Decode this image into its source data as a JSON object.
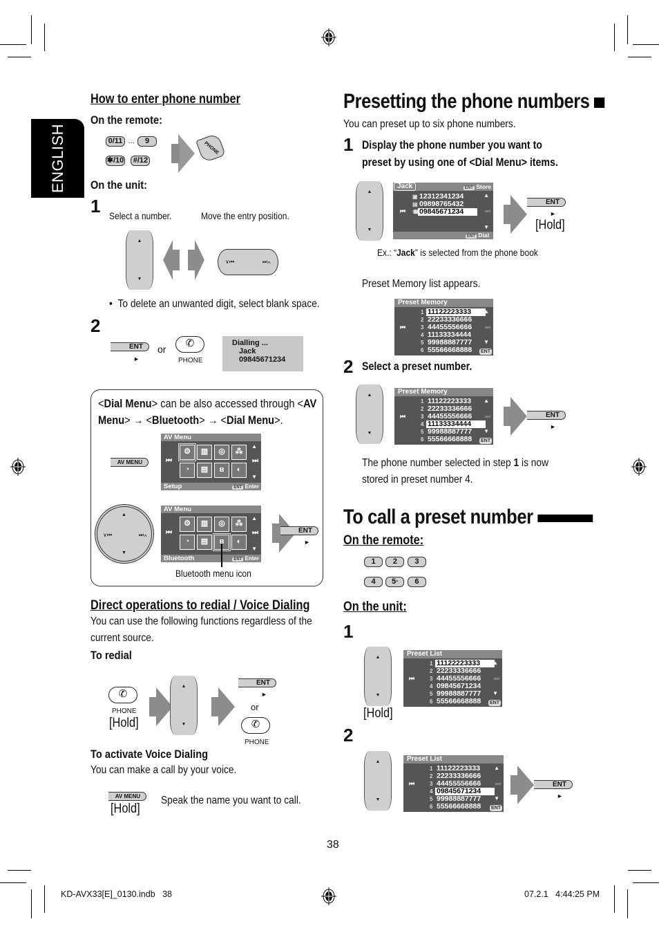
{
  "page": {
    "language_tab": "ENGLISH",
    "page_number": "38",
    "footer_file": "KD-AVX33[E]_0130.indb   38",
    "footer_timestamp": "07.2.1   4:44:25 PM"
  },
  "left": {
    "enter_number": {
      "heading": "How to enter phone number",
      "on_remote": "On the remote:",
      "remote_keys": [
        "0/11",
        "9",
        "✱/10",
        "#/12"
      ],
      "ellipsis": "...",
      "phone_key": "PHONE",
      "on_unit": "On the unit:",
      "step1_num": "1",
      "step1_label_a": "Select a number.",
      "step1_label_b": "Move the entry position.",
      "dial_left": "∨⏮",
      "dial_right": "⏭∧",
      "bullet": "To delete an unwanted digit, select blank space.",
      "step2_num": "2",
      "ent_label": "ENT",
      "or": "or",
      "phone_label": "PHONE",
      "display": [
        "Dialling ...",
        "Jack",
        "09845671234"
      ]
    },
    "infobox": {
      "line1_parts": [
        "<",
        "Dial Menu",
        "> can be also accessed through <",
        "AV"
      ],
      "line2_parts": [
        "Menu",
        "> → <",
        "Bluetooth",
        "> → <",
        "Dial Menu",
        ">."
      ],
      "av_menu_button": "AV MENU",
      "menu1": {
        "title": "AV Menu",
        "footer": "Setup",
        "enter": "Enter",
        "ent_chip": "ENT"
      },
      "menu2": {
        "title": "AV Menu",
        "footer": "Bluetooth",
        "enter": "Enter",
        "ent_chip": "ENT"
      },
      "menu_icons": [
        "setup-gears",
        "equalizer",
        "surround",
        "sound-field",
        "timer",
        "display",
        "bluetooth",
        "disc-sound"
      ],
      "ent_label": "ENT",
      "callout": "Bluetooth menu icon"
    },
    "direct": {
      "heading": "Direct operations to redial / Voice Dialing",
      "desc_line1": "You can use the following functions regardless of the",
      "desc_line2": "current source.",
      "redial_heading": "To redial",
      "phone_label": "PHONE",
      "hold": "[Hold]",
      "ent_label": "ENT",
      "or": "or",
      "phone_label2": "PHONE",
      "voice_heading": "To activate Voice Dialing",
      "voice_desc": "You can make a call by your voice.",
      "av_menu_button": "AV MENU",
      "voice_hold": "[Hold]",
      "voice_instruction": "Speak the name you want to call."
    }
  },
  "right": {
    "presetting": {
      "title": "Presetting the phone numbers",
      "intro": "You can preset up to six phone numbers.",
      "step1_num": "1",
      "step1_line1": "Display the phone number you want to",
      "step1_line2": "preset by using one of <Dial Menu> items.",
      "phonebook_lcd": {
        "name": "Jack",
        "store": "Store",
        "dial": "Dial",
        "ent_chip": "ENT",
        "entries": [
          {
            "type": "office",
            "number": "12312341234",
            "selected": false
          },
          {
            "type": "mobile",
            "number": "09898765432",
            "selected": false
          },
          {
            "type": "home",
            "number": "09845671234",
            "selected": true
          }
        ]
      },
      "ent_label": "ENT",
      "hold": "[Hold]",
      "example_pre": "Ex.: “",
      "example_name": "Jack",
      "example_post": "” is selected from the phone book",
      "preset_appears": "Preset Memory list appears.",
      "preset_lcd_1": {
        "title": "Preset Memory",
        "ent_chip": "ENT",
        "rows": [
          {
            "n": "1",
            "number": "11122223333",
            "selected": true
          },
          {
            "n": "2",
            "number": "22233336666",
            "selected": false
          },
          {
            "n": "3",
            "number": "44455556666",
            "selected": false
          },
          {
            "n": "4",
            "number": "11133334444",
            "selected": false
          },
          {
            "n": "5",
            "number": "99988887777",
            "selected": false
          },
          {
            "n": "6",
            "number": "55566668888",
            "selected": false
          }
        ]
      },
      "step2_num": "2",
      "step2_text": "Select a preset number.",
      "preset_lcd_2": {
        "title": "Preset Memory",
        "ent_chip": "ENT",
        "rows": [
          {
            "n": "1",
            "number": "11122223333",
            "selected": false
          },
          {
            "n": "2",
            "number": "22233336666",
            "selected": false
          },
          {
            "n": "3",
            "number": "44455556666",
            "selected": false
          },
          {
            "n": "4",
            "number": "11133334444",
            "selected": true
          },
          {
            "n": "5",
            "number": "99988887777",
            "selected": false
          },
          {
            "n": "6",
            "number": "55566668888",
            "selected": false
          }
        ]
      },
      "ent_label2": "ENT",
      "result_pre": "The phone number selected in step ",
      "result_step": "1",
      "result_post": " is now",
      "result_line2": "stored in preset number 4."
    },
    "call": {
      "title": "To call a preset number",
      "on_remote": "On the remote:",
      "keys_row1": [
        "1",
        "2",
        "3"
      ],
      "keys_row2": [
        "4",
        "5·",
        "6"
      ],
      "on_unit": "On the unit:",
      "step1_num": "1",
      "hold": "[Hold]",
      "preset_list_1": {
        "title": "Preset List",
        "ent_chip": "ENT",
        "rows": [
          {
            "n": "1",
            "number": "11122223333",
            "selected": true
          },
          {
            "n": "2",
            "number": "22233336666",
            "selected": false
          },
          {
            "n": "3",
            "number": "44455556666",
            "selected": false
          },
          {
            "n": "4",
            "number": "09845671234",
            "selected": false
          },
          {
            "n": "5",
            "number": "99988887777",
            "selected": false
          },
          {
            "n": "6",
            "number": "55566668888",
            "selected": false
          }
        ]
      },
      "step2_num": "2",
      "preset_list_2": {
        "title": "Preset List",
        "ent_chip": "ENT",
        "rows": [
          {
            "n": "1",
            "number": "11122223333",
            "selected": false
          },
          {
            "n": "2",
            "number": "22233336666",
            "selected": false
          },
          {
            "n": "3",
            "number": "44455556666",
            "selected": false
          },
          {
            "n": "4",
            "number": "09845671234",
            "selected": true
          },
          {
            "n": "5",
            "number": "99988887777",
            "selected": false
          },
          {
            "n": "6",
            "number": "55566668888",
            "selected": false
          }
        ]
      },
      "ent_label": "ENT"
    }
  }
}
